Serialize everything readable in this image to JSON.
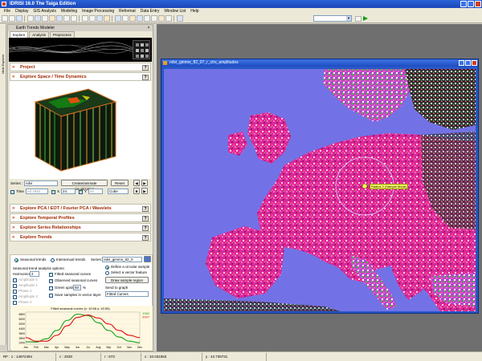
{
  "window": {
    "title": "IDRISI 16.0     The Taiga Edition"
  },
  "menu": [
    "File",
    "Display",
    "GIS Analysis",
    "Modeling",
    "Image Processing",
    "Reformat",
    "Data Entry",
    "Window List",
    "Help"
  ],
  "vertical_tab": "Idrisi Explorer",
  "panel": {
    "title": "Earth Trends Modeler",
    "tabs": [
      "Explore",
      "Analysis",
      "Preprocess"
    ],
    "sections": {
      "project": "Project",
      "space_time": "Explore Space / Time Dynamics",
      "pca": "Explore PCA / EOT / Fourier PCA / Wavelets",
      "temporal": "Explore Temporal Profiles",
      "series": "Explore Series Relationships",
      "trends": "Explore Trends"
    },
    "help_label": "?",
    "space_time_controls": {
      "series_label": "Series :",
      "series_value": "ndvi",
      "create_btn": "Create/animate visualization",
      "reset_btn": "Reset",
      "time_label": "Time",
      "time_value": "nd 1982",
      "x_label": "X",
      "x_value": "24",
      "y_label": "Y",
      "y_value": "50",
      "shape_value": "Cube"
    },
    "trends": {
      "seasonal_label": "Seasonal trends",
      "interannual_label": "Interannual trends",
      "series_label": "Series:",
      "series_value": "ndvi_gimms_82_0",
      "options_label": "Seasonal trend analysis options:",
      "harmonics_label": "Harmonics :",
      "harmonics_value": "2",
      "amplitudes": [
        "Amplitude 0",
        "Amplitude 1",
        "Phase 1",
        "Amplitude 2",
        "Phase 2"
      ],
      "fitted_curves_label": "Fitted seasonal curves",
      "observed_curves_label": "Observed seasonal curves",
      "green_up_label": "Green up/down",
      "green_up_value": "50",
      "green_up_unit": "%",
      "save_samples_label": "Save samples in vector layer",
      "define_circular": "Define a circular sample",
      "select_vector": "Select a vector feature",
      "draw_sample": "Draw sample region",
      "send_graph": "Send to graph",
      "curves_value": "Fitted Curves"
    }
  },
  "chart_data": {
    "type": "line",
    "title": "Fitted seasonal curves (x: 10.66  y: 43.59)",
    "categories": [
      "Jan",
      "Feb",
      "Mar",
      "Apr",
      "May",
      "Jun",
      "Jul",
      "Aug",
      "Sep",
      "Oct",
      "Nov",
      "Dec"
    ],
    "ylim": [
      1800,
      7200
    ],
    "yticks": [
      2000,
      2800,
      3600,
      4400,
      5200,
      6000,
      6800
    ],
    "series": [
      {
        "name": "1982",
        "color": "#18a018",
        "values": [
          2200,
          2150,
          2700,
          4100,
          5800,
          6850,
          6600,
          5400,
          4100,
          3000,
          2300,
          2050
        ]
      },
      {
        "name": "2007",
        "color": "#e01010",
        "values": [
          2900,
          2300,
          2300,
          3300,
          4900,
          6300,
          6700,
          6200,
          5200,
          4100,
          3300,
          2900
        ]
      }
    ]
  },
  "image_window": {
    "title": "ndvi_gimms_82_07_r_ctrs_amplitudes",
    "annotation": "Radius 2   (Sample Mode)"
  },
  "status": {
    "rf": "RF : 1 : 14972494",
    "c": "c : 2030",
    "r": "r : 573",
    "x": "x : 10.031553",
    "y": "y : 43.736731"
  }
}
